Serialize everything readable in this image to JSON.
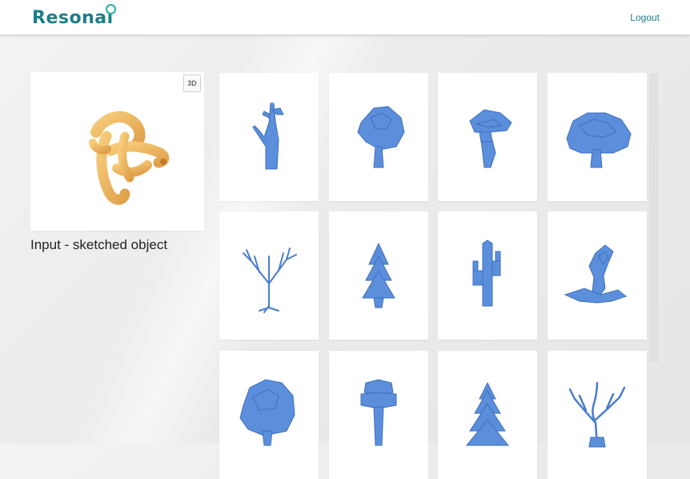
{
  "header": {
    "logo_text": "Resonai",
    "logout_label": "Logout"
  },
  "input_panel": {
    "badge_label": "3D",
    "caption": "Input - sketched object",
    "object_icon": "sketch-blob-icon"
  },
  "results": {
    "items": [
      {
        "icon": "dead-trunk-tree-icon"
      },
      {
        "icon": "leafy-tree-icon"
      },
      {
        "icon": "lowpoly-bonsai-icon"
      },
      {
        "icon": "bushy-tree-icon"
      },
      {
        "icon": "bare-branch-tree-icon"
      },
      {
        "icon": "pine-tree-icon"
      },
      {
        "icon": "cactus-icon"
      },
      {
        "icon": "twisted-trunk-icon"
      },
      {
        "icon": "dense-shrub-icon"
      },
      {
        "icon": "stacked-lowpoly-tree-icon"
      },
      {
        "icon": "spiky-pine-icon"
      },
      {
        "icon": "gnarled-branch-tree-icon"
      }
    ]
  },
  "colors": {
    "brand": "#1c7f88",
    "model_blue": "#5b8fdb",
    "model_blue_dark": "#3e6fbd",
    "sketch_orange": "#f0b357"
  }
}
